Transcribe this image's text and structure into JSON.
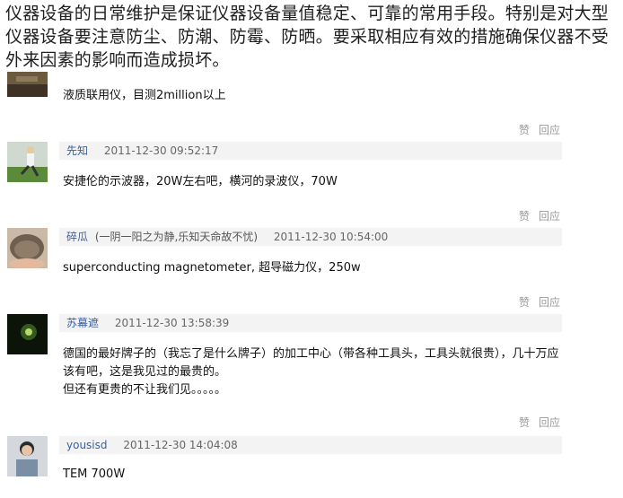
{
  "intro": "仪器设备的日常维护是保证仪器设备量值稳定、可靠的常用手段。特别是对大型仪器设备要注意防尘、防潮、防霉、防晒。要采取相应有效的措施确保仪器不受外来因素的影响而造成损坏。",
  "actions": {
    "like_label": "赞",
    "reply_label": "回应"
  },
  "comments": [
    {
      "text": "液质联用仪，目测2million以上"
    },
    {
      "username": "先知",
      "time": "2011-12-30 09:52:17",
      "text": "安捷伦的示波器，20W左右吧，横河的录波仪，70W"
    },
    {
      "username": "碎瓜",
      "tagline": "(一阴一阳之为静,乐知天命故不忧)",
      "time": "2011-12-30 10:54:00",
      "text": "superconducting magnetometer,  超导磁力仪，250w"
    },
    {
      "username": "苏幕遮",
      "time": "2011-12-30 13:58:39",
      "text_lines": [
        "德国的最好牌子的（我忘了是什么牌子）的加工中心（带各种工具头，工具头就很贵），几十万应",
        "该有吧，这是我见过的最贵的。",
        "但还有更贵的不让我们见。。。。。"
      ]
    },
    {
      "username": "yousisd",
      "time": "2011-12-30 14:04:08",
      "text": "TEM 700W"
    }
  ]
}
